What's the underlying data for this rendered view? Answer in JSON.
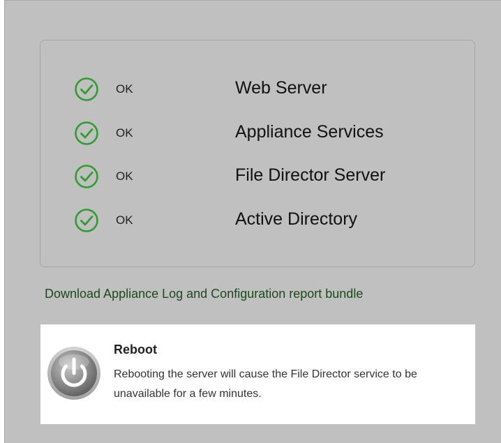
{
  "status": {
    "rows": [
      {
        "icon": "check-circle-icon",
        "state": "OK",
        "service": "Web Server"
      },
      {
        "icon": "check-circle-icon",
        "state": "OK",
        "service": "Appliance Services"
      },
      {
        "icon": "check-circle-icon",
        "state": "OK",
        "service": "File Director Server"
      },
      {
        "icon": "check-circle-icon",
        "state": "OK",
        "service": "Active Directory"
      }
    ],
    "ok_color": "#2e9e2e"
  },
  "download": {
    "label": "Download Appliance Log and Configuration report bundle"
  },
  "reboot": {
    "icon": "power-icon",
    "title": "Reboot",
    "description": "Rebooting the server will cause the File Director service to be unavailable for a few minutes."
  }
}
